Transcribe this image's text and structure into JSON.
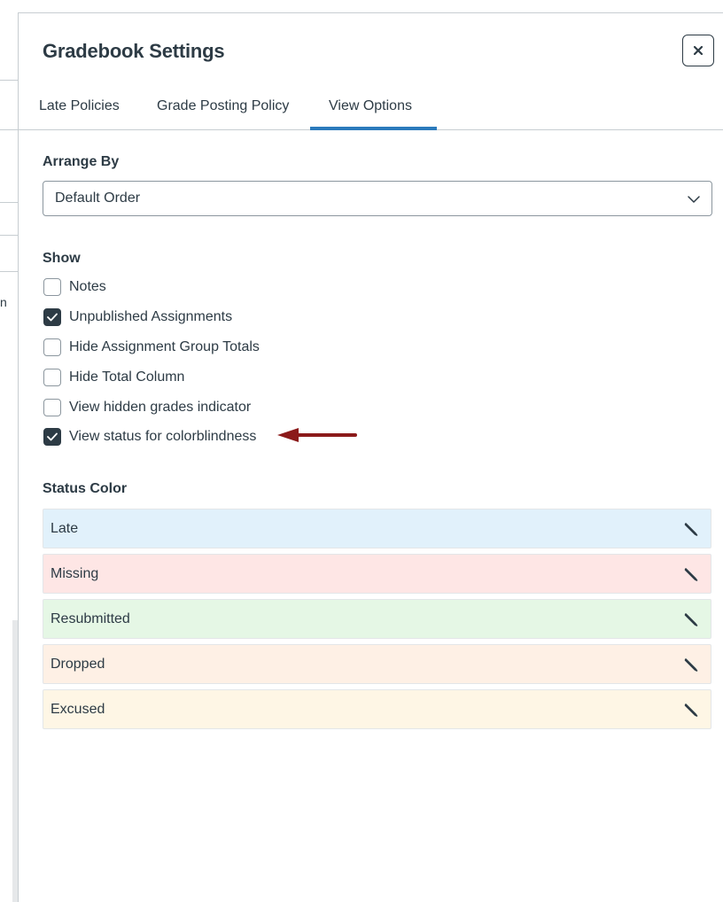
{
  "modal": {
    "title": "Gradebook Settings",
    "close_label": "×"
  },
  "background": {
    "fragment_char": "n"
  },
  "tabs": [
    {
      "label": "Late Policies",
      "active": false
    },
    {
      "label": "Grade Posting Policy",
      "active": false
    },
    {
      "label": "View Options",
      "active": true
    }
  ],
  "arrange_by": {
    "label": "Arrange By",
    "selected": "Default Order"
  },
  "show": {
    "label": "Show",
    "options": [
      {
        "label": "Notes",
        "checked": false
      },
      {
        "label": "Unpublished Assignments",
        "checked": true
      },
      {
        "label": "Hide Assignment Group Totals",
        "checked": false
      },
      {
        "label": "Hide Total Column",
        "checked": false
      },
      {
        "label": "View hidden grades indicator",
        "checked": false
      },
      {
        "label": "View status for colorblindness",
        "checked": true
      }
    ]
  },
  "status_color": {
    "label": "Status Color",
    "items": [
      {
        "label": "Late",
        "color": "#e1f1fb"
      },
      {
        "label": "Missing",
        "color": "#fee6e5"
      },
      {
        "label": "Resubmitted",
        "color": "#e5f7e5"
      },
      {
        "label": "Dropped",
        "color": "#fef0e5"
      },
      {
        "label": "Excused",
        "color": "#fef6e5"
      }
    ]
  },
  "colors": {
    "accent": "#2b7abc",
    "text": "#2d3b45",
    "annotation_arrow": "#8b1a1a"
  }
}
